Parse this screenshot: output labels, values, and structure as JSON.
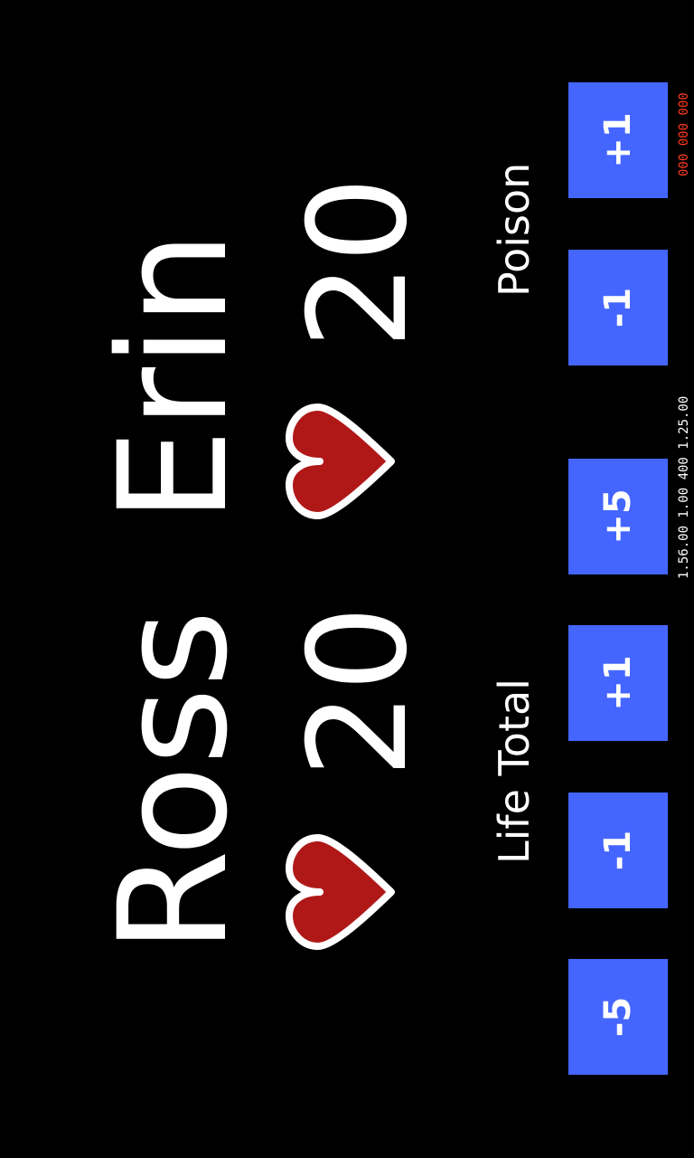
{
  "players": [
    {
      "name": "Ross",
      "life": "20"
    },
    {
      "name": "Erin",
      "life": "20"
    }
  ],
  "labels": {
    "life_total": "Life Total",
    "poison": "Poison"
  },
  "buttons": {
    "life_minus5": "-5",
    "life_minus1": "-1",
    "life_plus1": "+1",
    "life_plus5": "+5",
    "poison_minus1": "-1",
    "poison_plus1": "+1"
  },
  "icons": {
    "heart": "heart-icon"
  },
  "colors": {
    "background": "#000000",
    "button": "#4466ff",
    "heart": "#b01818",
    "heart_outline": "#ffffff",
    "text": "#ffffff",
    "stats_white": "#ffffff",
    "stats_red": "#ff3b1f"
  },
  "debug_counters": {
    "white": "1.56.00 1.00 400 1.25.00",
    "red": "000 000 000"
  }
}
